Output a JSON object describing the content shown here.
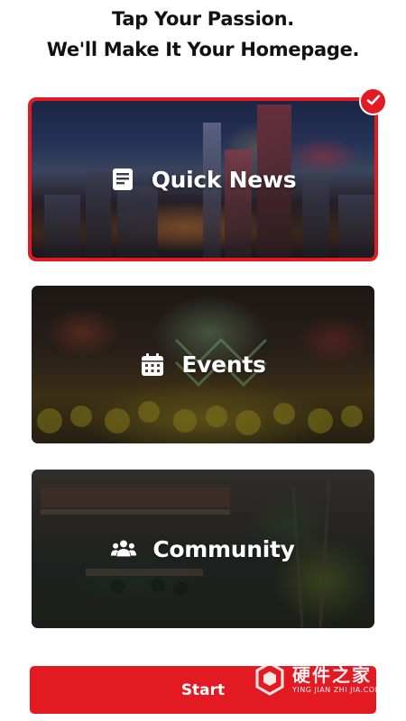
{
  "header": {
    "line1": "Tap Your Passion.",
    "line2": "We'll Make It Your Homepage."
  },
  "cards": [
    {
      "label": "Quick News",
      "icon": "news-icon",
      "selected": true
    },
    {
      "label": "Events",
      "icon": "calendar-icon",
      "selected": false
    },
    {
      "label": "Community",
      "icon": "people-icon",
      "selected": false
    }
  ],
  "badge": {
    "icon": "checkmark-icon"
  },
  "start": {
    "label": "Start"
  },
  "watermark": {
    "title": "硬件之家",
    "subtitle": "YING JIAN ZHI JIA.COM"
  },
  "colors": {
    "accent": "#e41a23",
    "text": "#111111",
    "card_text": "#ffffff"
  }
}
